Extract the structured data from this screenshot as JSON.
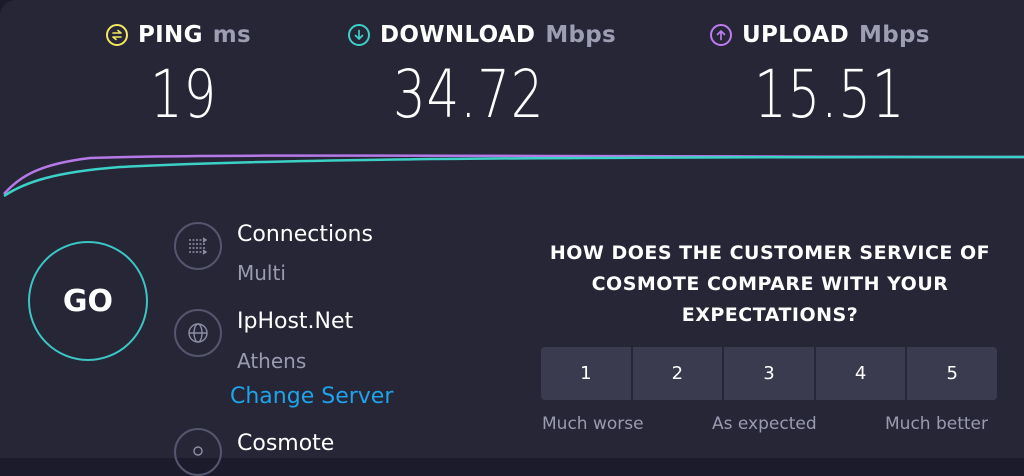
{
  "metrics": {
    "ping": {
      "label": "PING",
      "unit": "ms",
      "value": "19",
      "color": "#f4e85f",
      "icon": "ping-icon"
    },
    "download": {
      "label": "DOWNLOAD",
      "unit": "Mbps",
      "value": "34.72",
      "color": "#3cd1c7",
      "icon": "download-arrow-icon"
    },
    "upload": {
      "label": "UPLOAD",
      "unit": "Mbps",
      "value": "15.51",
      "color": "#bd7cf2",
      "icon": "upload-arrow-icon"
    }
  },
  "go": {
    "label": "GO"
  },
  "connections": {
    "title": "Connections",
    "mode": "Multi",
    "icon": "connections-icon"
  },
  "server": {
    "name": "IpHost.Net",
    "location": "Athens",
    "change_label": "Change Server",
    "icon": "globe-icon"
  },
  "provider": {
    "name": "Cosmote",
    "icon": "user-icon"
  },
  "survey": {
    "question_line1": "HOW DOES THE CUSTOMER SERVICE OF",
    "question_line2": "COSMOTE COMPARE WITH YOUR",
    "question_line3": "EXPECTATIONS?",
    "options": [
      "1",
      "2",
      "3",
      "4",
      "5"
    ],
    "scale": {
      "low": "Much worse",
      "mid": "As expected",
      "high": "Much better"
    }
  },
  "colors": {
    "background": "#262637",
    "accent_link": "#1fa3ea",
    "go_ring": "#3bc5c3"
  }
}
